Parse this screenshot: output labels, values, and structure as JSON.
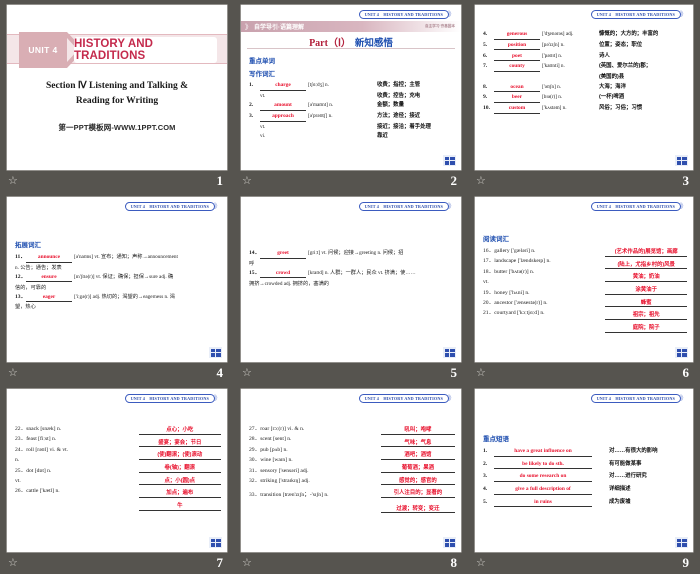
{
  "common": {
    "unit_tag": "UNIT 4　HISTORY AND TRADITIONS",
    "chevron": "》"
  },
  "slides": [
    {
      "page": "1",
      "type": "title",
      "unit_label": "UNIT 4",
      "title": "HISTORY AND TRADITIONS",
      "section_line1": "Section Ⅳ Listening and Talking &",
      "section_line2": "Reading for Writing",
      "watermark": "第一PPT模板网-WWW.1PPT.COM"
    },
    {
      "page": "2",
      "type": "words",
      "band_left": "自学导引·语篇理解",
      "band_right": "自主学习·夯基固本",
      "part_en": "Part（Ⅰ）",
      "part_cn": "新知感悟",
      "sec_head": "重点单词",
      "sub_head": "写作词汇",
      "entries": [
        {
          "num": "1.",
          "answer": "charge",
          "phonetic": "[tʃɑːdʒ] n.",
          "meaning": "收费；指控；主管"
        },
        {
          "num": "",
          "answer": "",
          "phonetic": "vt.",
          "meaning": "收费；控告；充电"
        },
        {
          "num": "2.",
          "answer": "amount",
          "phonetic": "[ə'maʊnt] n.",
          "meaning": "金额；数量"
        },
        {
          "num": "3.",
          "answer": "approach",
          "phonetic": "[ə'prəʊtʃ] n.",
          "meaning": "方法；途径；接近"
        },
        {
          "num": "",
          "answer": "",
          "phonetic": "vt.",
          "meaning": "接近；接洽；着手处理"
        },
        {
          "num": "",
          "answer": "",
          "phonetic": "vi.",
          "meaning": "靠近"
        }
      ]
    },
    {
      "page": "3",
      "type": "words",
      "entries": [
        {
          "num": "4.",
          "answer": "generous",
          "phonetic": "['dʒenərəs] adj.",
          "meaning": "慷慨的；大方的；丰富的"
        },
        {
          "num": "5.",
          "answer": "position",
          "phonetic": "[pə'zɪʃn] n.",
          "meaning": "位置；姿态；职位"
        },
        {
          "num": "6.",
          "answer": "poet",
          "phonetic": "['pəʊɪt] n.",
          "meaning": "诗人"
        },
        {
          "num": "7.",
          "answer": "county",
          "phonetic": "['kaʊnti] n.",
          "meaning": "(英国、爱尔兰的)郡；"
        },
        {
          "num": "",
          "answer": "",
          "phonetic": "",
          "meaning": "(美国的)县"
        },
        {
          "num": "8.",
          "answer": "ocean",
          "phonetic": "['əʊʃn] n.",
          "meaning": "大海；海洋"
        },
        {
          "num": "9.",
          "answer": "beer",
          "phonetic": "[bɪə(r)] n.",
          "meaning": "(一杯)啤酒"
        },
        {
          "num": "10.",
          "answer": "custom",
          "phonetic": "['kʌstəm] n.",
          "meaning": "风俗；习俗；习惯"
        }
      ]
    },
    {
      "page": "4",
      "type": "flow",
      "sec_head": "拓展词汇",
      "lines": [
        "11．__announce__ [ə'naʊns] vt. 宣布；通知；声称→announcement n. 公告；通告；发表",
        "12．__ensure__ [ɪn'ʃʊə(r)] vt. 保证；确保；担保→sure adj. 确信的，可靠的",
        "13．__eager__ ['iːgə(r)] adj. 热切的；渴望的→eagerness n. 渴望，热心"
      ],
      "entries": [
        {
          "num": "11．",
          "answer": "announce",
          "rest": "[ə'naʊns] vt. 宣布；通知；声称→announcement",
          "rest2": "n. 公告；通告；发表"
        },
        {
          "num": "12．",
          "answer": "ensure",
          "rest": "[ɪn'ʃʊə(r)] vt. 保证；确保；担保→sure adj. 确",
          "rest2": "信的，可靠的"
        },
        {
          "num": "13．",
          "answer": "eager",
          "rest": "['iːgə(r)] adj. 热切的；渴望的→eagerness n. 渴",
          "rest2": "望，热心"
        }
      ]
    },
    {
      "page": "5",
      "type": "flow",
      "entries": [
        {
          "num": "14．",
          "answer": "greet",
          "rest": "[griːt] vt. 问候；迎接→greeting n. 问候；招",
          "rest2": "呼"
        },
        {
          "num": "15．",
          "answer": "crowd",
          "rest": "[kraʊd] n. 人群；一群人；民众 vt. 挤满；使……",
          "rest2": "拥挤→crowded adj. 拥挤的，塞满的"
        }
      ]
    },
    {
      "page": "6",
      "type": "twocol",
      "sec_head": "阅读词汇",
      "left": [
        "16．gallery ['gæləri] n.",
        "17．landscape ['lændskeɪp] n.",
        "18．butter ['bʌtə(r)] n.",
        "vt.",
        "19．honey ['hʌni] n.",
        "20．ancestor ['ænsestə(r)] n.",
        "21．courtyard ['kɔːtjɑːd] n."
      ],
      "right": [
        "(艺术作品的)展览馆；画廊",
        "(陆上，尤指乡村的)风景",
        "黄油；奶油",
        "涂黄油于",
        "蜂蜜",
        "祖宗；祖先",
        "庭院；院子"
      ]
    },
    {
      "page": "7",
      "type": "twocol",
      "left": [
        "22．snack [snæk] n.",
        "23．feast [fiːst] n.",
        "24．roll [rəʊl] vi. & vt.",
        "n.",
        "25．dot [dɒt] n.",
        "vt.",
        "26．cattle ['kætl] n."
      ],
      "right": [
        "点心；小吃",
        "盛宴；宴会；节日",
        "(使)翻滚；(使)滚动",
        "卷(轴)；翻滚",
        "点；小(圆)点",
        "加点；遍布",
        "牛"
      ]
    },
    {
      "page": "8",
      "type": "twocol",
      "left": [
        "27．roar [rɔː(r)] vi. & n.",
        "28．scent [sent] n.",
        "29．pub [pʌb] n.",
        "30．wine [waɪn] n.",
        "31．sensory ['sensəri] adj.",
        "32．striking ['straɪkɪŋ] adj.",
        "33．transition [træn'zɪʃn；-'sɪʃn] n."
      ],
      "right": [
        "吼叫；咆哮",
        "气味；气息",
        "酒吧；酒馆",
        "葡萄酒；果酒",
        "感觉的；感官的",
        "引人注目的；显著的",
        "过渡；转变；变迁"
      ]
    },
    {
      "page": "9",
      "type": "phrases",
      "sec_head": "重点短语",
      "entries": [
        {
          "num": "1.",
          "answer": "have a great influence on",
          "meaning": "对……有很大的影响"
        },
        {
          "num": "2.",
          "answer": "be likely to do sth.",
          "meaning": "有可能做某事"
        },
        {
          "num": "3.",
          "answer": "do some research on",
          "meaning": "对……进行研究"
        },
        {
          "num": "4.",
          "answer": "give a full description of",
          "meaning": "详细描述"
        },
        {
          "num": "5.",
          "answer": "in ruins",
          "meaning": "成为废墟"
        }
      ]
    }
  ]
}
